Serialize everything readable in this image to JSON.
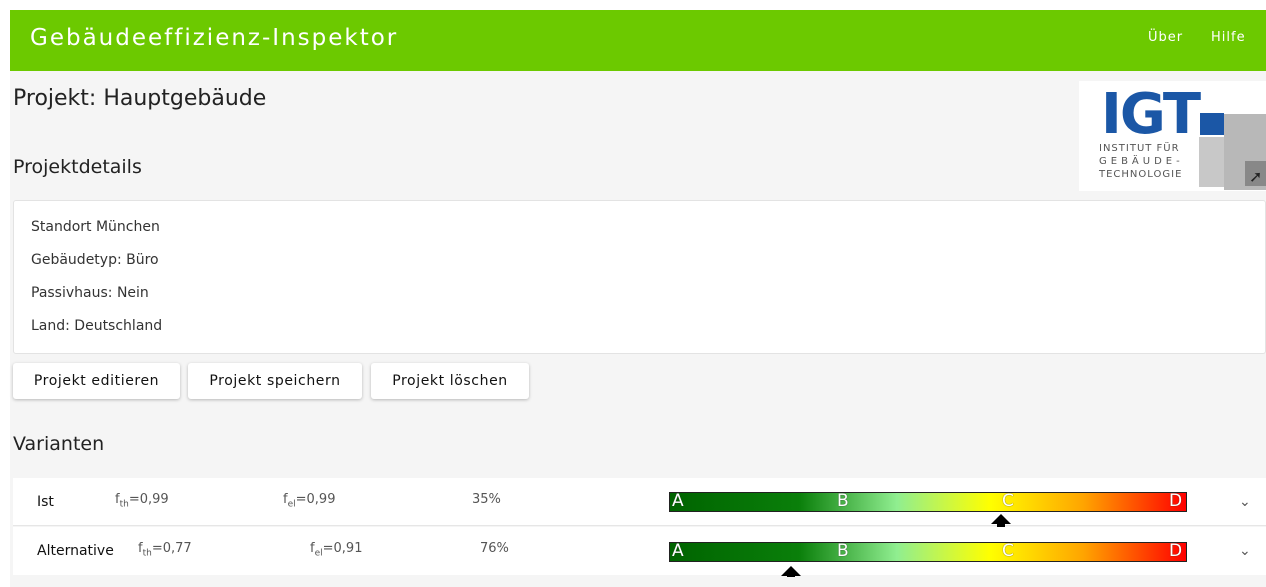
{
  "app": {
    "title": "Gebäudeeffizienz-Inspektor"
  },
  "nav": {
    "about": "Über",
    "help": "Hilfe"
  },
  "project": {
    "title": "Projekt: Hauptgebäude"
  },
  "logo": {
    "text": "IGT",
    "line1": "INSTITUT FÜR",
    "line2": "GEBÄUDE-",
    "line3": "TECHNOLOGIE"
  },
  "details": {
    "heading": "Projektdetails",
    "lines": [
      "Standort München",
      "Gebäudetyp: Büro",
      "Passivhaus: Nein",
      "Land: Deutschland"
    ]
  },
  "buttons": {
    "edit": "Projekt editieren",
    "save": "Projekt speichern",
    "delete": "Projekt löschen"
  },
  "variants": {
    "heading": "Varianten",
    "scale_letters": [
      "A",
      "B",
      "C",
      "D"
    ],
    "items": [
      {
        "name": "Ist",
        "fth_label": "f",
        "fth_sub": "th",
        "fth_value": "=0,99",
        "fel_label": "f",
        "fel_sub": "el",
        "fel_value": "=0,99",
        "percent": "35%",
        "marker_position": 0.64
      },
      {
        "name": "Alternative",
        "fth_label": "f",
        "fth_sub": "th",
        "fth_value": "=0,77",
        "fel_label": "f",
        "fel_sub": "el",
        "fel_value": "=0,91",
        "percent": "76%",
        "marker_position": 0.235
      }
    ]
  },
  "icons": {
    "chevron": "chevron-down-icon",
    "marker": "arrow-up-icon"
  },
  "colors": {
    "accent": "#6cc900",
    "logo_blue": "#1b57a6"
  }
}
